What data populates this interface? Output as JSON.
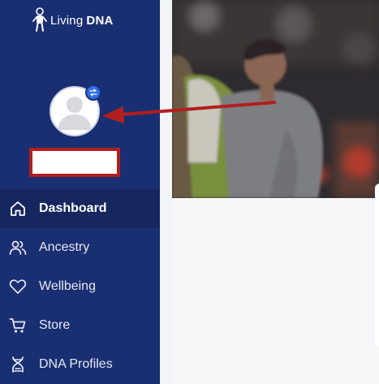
{
  "brand": {
    "name_part1": "Living",
    "name_part2": "DNA"
  },
  "user": {
    "name": ""
  },
  "nav": {
    "items": [
      {
        "label": "Dashboard",
        "icon": "home-icon",
        "active": true
      },
      {
        "label": "Ancestry",
        "icon": "people-icon",
        "active": false
      },
      {
        "label": "Wellbeing",
        "icon": "heart-icon",
        "active": false
      },
      {
        "label": "Store",
        "icon": "cart-icon",
        "active": false
      },
      {
        "label": "DNA Profiles",
        "icon": "dna-icon",
        "active": false
      }
    ]
  },
  "colors": {
    "sidebar": "#1a2f72",
    "sidebar_active": "#16275f",
    "annotation_red": "#b21f1f",
    "badge_blue": "#2f6de3"
  }
}
